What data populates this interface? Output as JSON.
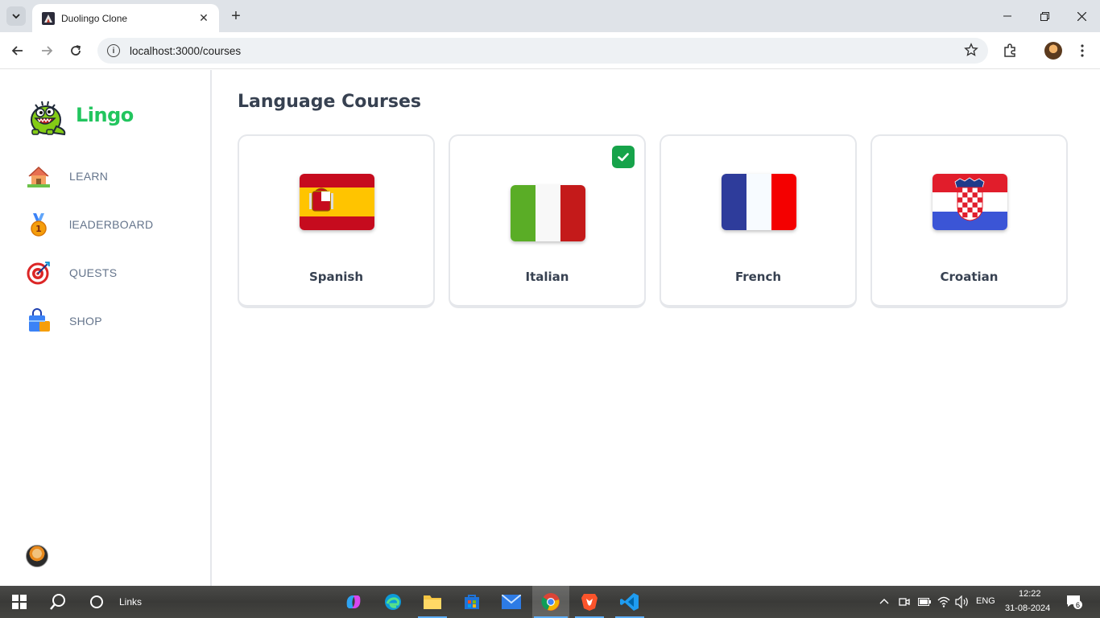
{
  "browser": {
    "tab_title": "Duolingo Clone",
    "url": "localhost:3000/courses",
    "close_tab": "✕",
    "new_tab": "+"
  },
  "sidebar": {
    "brand": "Lingo",
    "items": [
      {
        "label": "LEARN",
        "icon": "house-icon"
      },
      {
        "label": "lEADERBOARD",
        "icon": "medal-icon"
      },
      {
        "label": "QUESTS",
        "icon": "target-icon"
      },
      {
        "label": "SHOP",
        "icon": "shopping-bag-icon"
      }
    ]
  },
  "main": {
    "title": "Language Courses",
    "courses": [
      {
        "name": "Spanish",
        "active": false,
        "flag": "spain-flag"
      },
      {
        "name": "Italian",
        "active": true,
        "flag": "italy-flag"
      },
      {
        "name": "French",
        "active": false,
        "flag": "france-flag"
      },
      {
        "name": "Croatian",
        "active": false,
        "flag": "croatia-flag"
      }
    ]
  },
  "taskbar": {
    "search_label": "Links",
    "lang": "ENG",
    "time": "12:22",
    "date": "31-08-2024",
    "notifications": "6"
  },
  "colors": {
    "brand": "#22c55e",
    "check": "#16a34a",
    "text": "#374151",
    "nav_text": "#64748b"
  }
}
